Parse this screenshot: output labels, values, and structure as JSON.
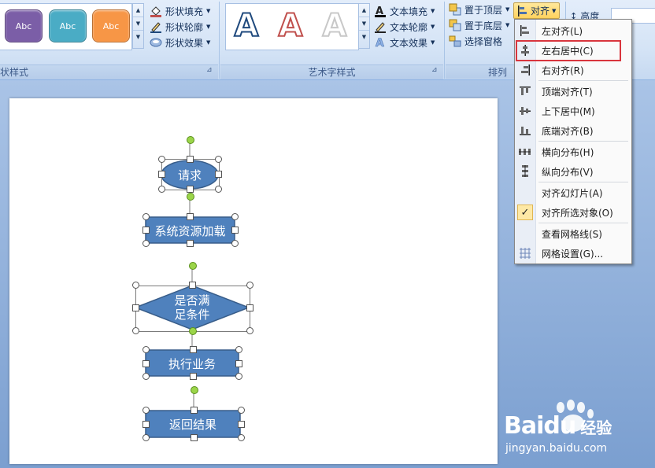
{
  "ribbon": {
    "shape_styles": {
      "label": "状样式",
      "swatches": [
        {
          "text": "Abc",
          "color": "#7b5ea7"
        },
        {
          "text": "Abc",
          "color": "#4aacc5"
        },
        {
          "text": "Abc",
          "color": "#f79646"
        }
      ],
      "fill": "形状填充",
      "outline": "形状轮廓",
      "effects": "形状效果"
    },
    "wordart_styles": {
      "label": "艺术字样式",
      "samples": [
        "A",
        "A",
        "A"
      ],
      "text_fill": "文本填充",
      "text_outline": "文本轮廓",
      "text_effects": "文本效果"
    },
    "arrange": {
      "label": "排列",
      "bring_front": "置于顶层",
      "send_back": "置于底层",
      "selection_pane": "选择窗格",
      "align": "对齐",
      "height_label": "高度"
    }
  },
  "menu": {
    "items": [
      {
        "label": "左对齐(L)",
        "icon": "align-left-icon"
      },
      {
        "label": "左右居中(C)",
        "icon": "align-center-icon"
      },
      {
        "label": "右对齐(R)",
        "icon": "align-right-icon"
      },
      {
        "label": "顶端对齐(T)",
        "icon": "align-top-icon"
      },
      {
        "label": "上下居中(M)",
        "icon": "align-middle-icon"
      },
      {
        "label": "底端对齐(B)",
        "icon": "align-bottom-icon"
      },
      {
        "label": "横向分布(H)",
        "icon": "distribute-horizontal-icon"
      },
      {
        "label": "纵向分布(V)",
        "icon": "distribute-vertical-icon"
      },
      {
        "label": "对齐幻灯片(A)",
        "icon": "none"
      },
      {
        "label": "对齐所选对象(O)",
        "icon": "checkmark-icon",
        "checked": true
      },
      {
        "label": "查看网格线(S)",
        "icon": "none"
      },
      {
        "label": "网格设置(G)...",
        "icon": "grid-icon"
      }
    ],
    "highlighted_index": 1
  },
  "slide": {
    "shapes": [
      {
        "type": "ellipse",
        "text": "请求"
      },
      {
        "type": "rect",
        "text": "系统资源加载"
      },
      {
        "type": "diamond",
        "text_line1": "是否满",
        "text_line2": "足条件"
      },
      {
        "type": "rect",
        "text": "执行业务"
      },
      {
        "type": "rect",
        "text": "返回结果"
      }
    ],
    "shape_fill": "#4f81bd",
    "shape_border": "#385d8a"
  },
  "watermark": {
    "brand": "Baidu",
    "suffix": "经验",
    "url": "jingyan.baidu.com"
  }
}
